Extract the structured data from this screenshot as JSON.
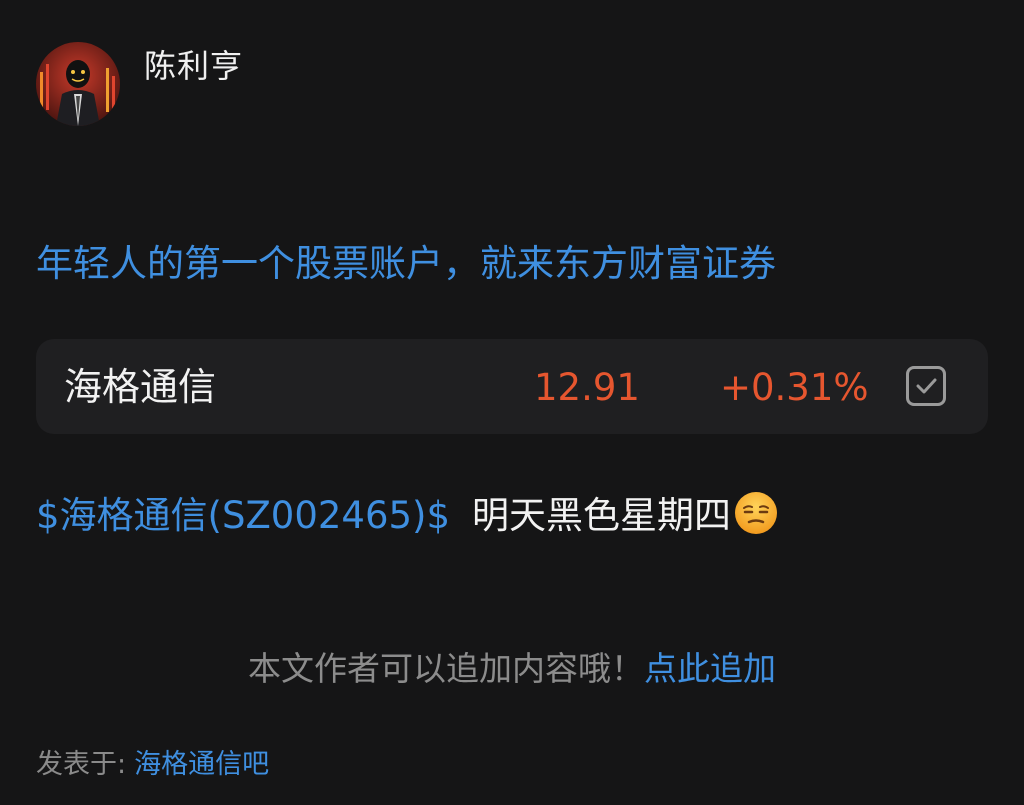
{
  "author": {
    "name": "陈利亨",
    "avatar_icon": "masked-man-in-suit-avatar"
  },
  "promo": {
    "text": "年轻人的第一个股票账户，就来东方财富证券"
  },
  "stock_card": {
    "name": "海格通信",
    "price": "12.91",
    "change": "+0.31%",
    "watch_icon": "checkbox-icon",
    "up_color": "#e6562f"
  },
  "post": {
    "stock_tag": "$海格通信(SZ002465)$",
    "text": "明天黑色星期四",
    "emoji": "unamused-face-emoji"
  },
  "append": {
    "hint": "本文作者可以追加内容哦！",
    "link": "点此追加"
  },
  "footer": {
    "posted_prefix": "发表于:",
    "forum": "海格通信吧"
  },
  "colors": {
    "background": "#151516",
    "link": "#3f8fe0",
    "card": "#1f1f21"
  }
}
